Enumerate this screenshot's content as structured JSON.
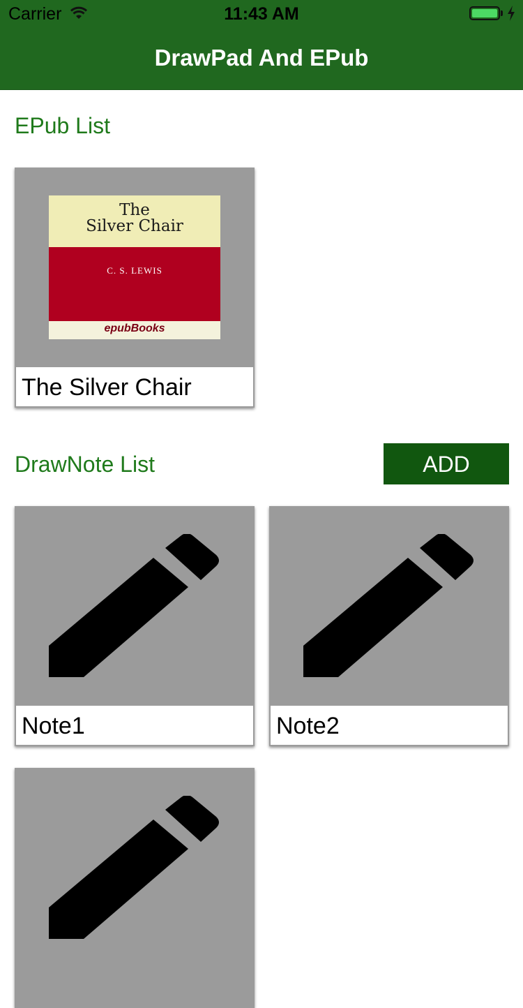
{
  "status_bar": {
    "carrier": "Carrier",
    "time": "11:43 AM",
    "battery_color": "#4cd964"
  },
  "nav_bar": {
    "title": "DrawPad And EPub",
    "background_color": "#20681f"
  },
  "epub_section": {
    "title": "EPub List",
    "items": [
      {
        "title": "The Silver Chair",
        "cover": {
          "title_line1": "The",
          "title_line2": "Silver Chair",
          "author": "C. S. LEWIS",
          "publisher": "epubBooks"
        }
      }
    ]
  },
  "drawnote_section": {
    "title": "DrawNote List",
    "add_button_label": "ADD",
    "items": [
      {
        "title": "Note1",
        "icon": "pencil-icon"
      },
      {
        "title": "Note2",
        "icon": "pencil-icon"
      },
      {
        "title": "",
        "icon": "pencil-icon"
      }
    ]
  },
  "colors": {
    "accent_text": "#1f7a1b",
    "add_button": "#11570f",
    "card_background": "#9b9b9b"
  }
}
